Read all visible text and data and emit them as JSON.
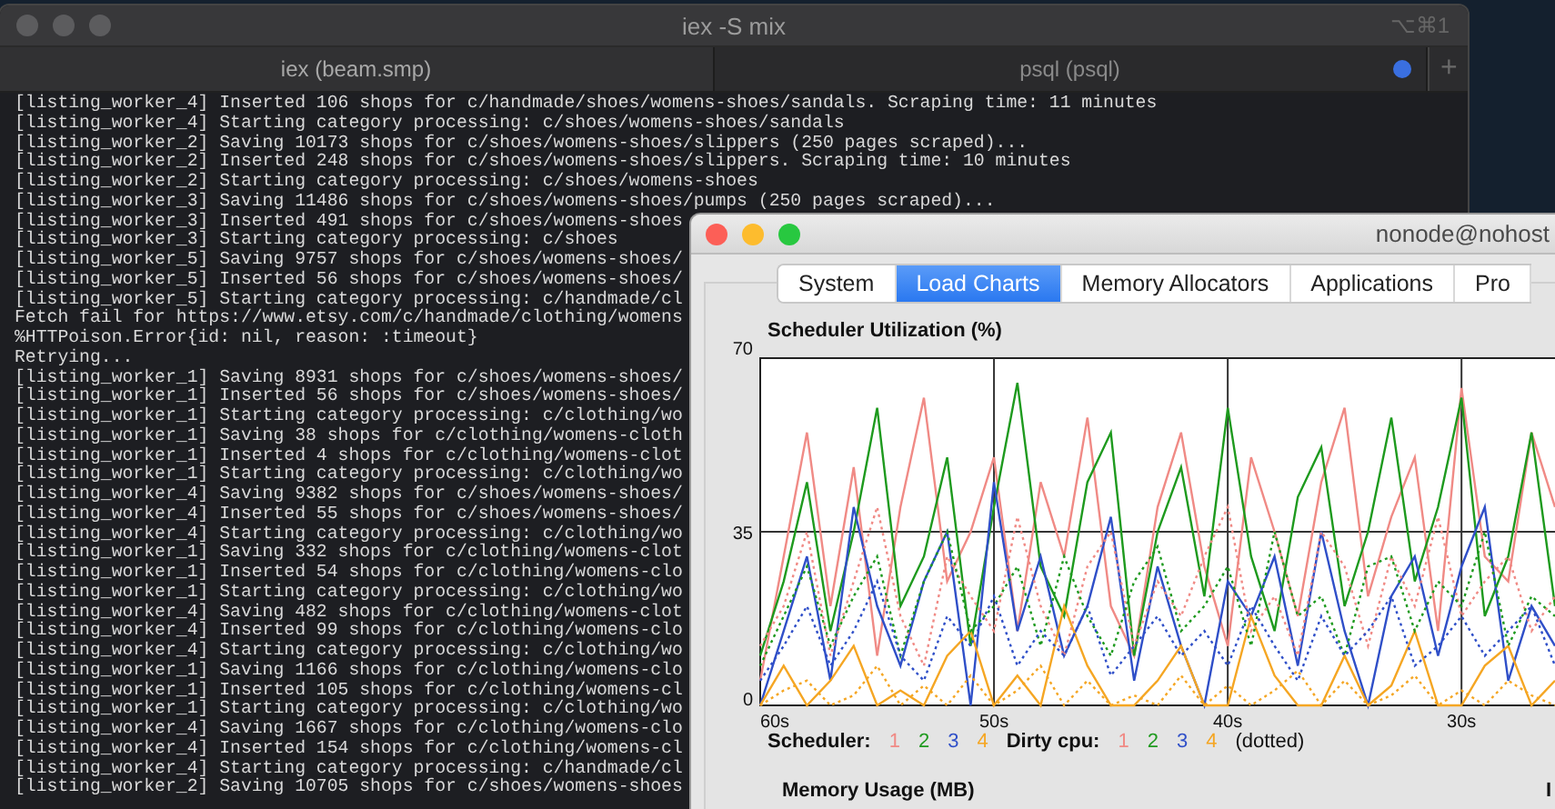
{
  "terminal": {
    "title": "iex -S mix",
    "shortcut": "⌥⌘1",
    "tabs": [
      {
        "label": "iex (beam.smp)",
        "selected": true,
        "activity": false
      },
      {
        "label": "psql (psql)",
        "selected": false,
        "activity": true
      }
    ],
    "new_tab": "+",
    "lines": [
      "[listing_worker_4] Inserted 106 shops for c/handmade/shoes/womens-shoes/sandals. Scraping time: 11 minutes",
      "[listing_worker_4] Starting category processing: c/shoes/womens-shoes/sandals",
      "[listing_worker_2] Saving 10173 shops for c/shoes/womens-shoes/slippers (250 pages scraped)...",
      "[listing_worker_2] Inserted 248 shops for c/shoes/womens-shoes/slippers. Scraping time: 10 minutes",
      "[listing_worker_2] Starting category processing: c/shoes/womens-shoes",
      "[listing_worker_3] Saving 11486 shops for c/shoes/womens-shoes/pumps (250 pages scraped)...",
      "[listing_worker_3] Inserted 491 shops for c/shoes/womens-shoes",
      "[listing_worker_3] Starting category processing: c/shoes",
      "[listing_worker_5] Saving 9757 shops for c/shoes/womens-shoes/",
      "[listing_worker_5] Inserted 56 shops for c/shoes/womens-shoes/",
      "[listing_worker_5] Starting category processing: c/handmade/cl",
      "Fetch fail for https://www.etsy.com/c/handmade/clothing/womens",
      "%HTTPoison.Error{id: nil, reason: :timeout}",
      "Retrying...",
      "[listing_worker_1] Saving 8931 shops for c/shoes/womens-shoes/",
      "[listing_worker_1] Inserted 56 shops for c/shoes/womens-shoes/",
      "[listing_worker_1] Starting category processing: c/clothing/wo",
      "[listing_worker_1] Saving 38 shops for c/clothing/womens-cloth",
      "[listing_worker_1] Inserted 4 shops for c/clothing/womens-clot",
      "[listing_worker_1] Starting category processing: c/clothing/wo",
      "[listing_worker_4] Saving 9382 shops for c/shoes/womens-shoes/",
      "[listing_worker_4] Inserted 55 shops for c/shoes/womens-shoes/",
      "[listing_worker_4] Starting category processing: c/clothing/wo",
      "[listing_worker_1] Saving 332 shops for c/clothing/womens-clot",
      "[listing_worker_1] Inserted 54 shops for c/clothing/womens-clo",
      "[listing_worker_1] Starting category processing: c/clothing/wo",
      "[listing_worker_4] Saving 482 shops for c/clothing/womens-clot",
      "[listing_worker_4] Inserted 99 shops for c/clothing/womens-clo",
      "[listing_worker_4] Starting category processing: c/clothing/wo",
      "[listing_worker_1] Saving 1166 shops for c/clothing/womens-clo",
      "[listing_worker_1] Inserted 105 shops for c/clothing/womens-cl",
      "[listing_worker_1] Starting category processing: c/clothing/wo",
      "[listing_worker_4] Saving 1667 shops for c/clothing/womens-clo",
      "[listing_worker_4] Inserted 154 shops for c/clothing/womens-cl",
      "[listing_worker_4] Starting category processing: c/handmade/cl",
      "[listing_worker_2] Saving 10705 shops for c/shoes/womens-shoes"
    ]
  },
  "observer": {
    "title": "nonode@nohost",
    "tabs": [
      {
        "label": "System",
        "selected": false
      },
      {
        "label": "Load Charts",
        "selected": true
      },
      {
        "label": "Memory Allocators",
        "selected": false
      },
      {
        "label": "Applications",
        "selected": false
      },
      {
        "label": "Pro",
        "selected": false
      }
    ],
    "scheduler_chart": {
      "chart_data": {
        "type": "line",
        "title": "Scheduler Utilization (%)",
        "grid": true,
        "x": [
          60,
          59,
          58,
          57,
          56,
          55,
          54,
          53,
          52,
          51,
          50,
          49,
          48,
          47,
          46,
          45,
          44,
          43,
          42,
          41,
          40,
          39,
          38,
          37,
          36,
          35,
          34,
          33,
          32,
          31,
          30,
          29,
          28,
          27,
          26
        ],
        "xlim": [
          60,
          26
        ],
        "ylim": [
          0,
          70
        ],
        "xticks": [
          {
            "value": 60,
            "label": "60s"
          },
          {
            "value": 50,
            "label": "50s"
          },
          {
            "value": 40,
            "label": "40s"
          },
          {
            "value": 30,
            "label": "30s"
          }
        ],
        "yticks": [
          0,
          35,
          70
        ],
        "series": [
          {
            "line_style": "solid",
            "color": "#f08a85",
            "values": [
              5,
              30,
              55,
              20,
              48,
              10,
              40,
              62,
              25,
              35,
              50,
              15,
              45,
              30,
              58,
              20,
              10,
              40,
              55,
              28,
              12,
              50,
              35,
              18,
              45,
              60,
              22,
              38,
              50,
              15,
              64,
              30,
              25,
              55,
              40
            ]
          },
          {
            "line_style": "solid",
            "color": "#1e9a1e",
            "values": [
              10,
              25,
              45,
              15,
              35,
              60,
              20,
              30,
              50,
              12,
              40,
              65,
              28,
              18,
              45,
              55,
              10,
              35,
              48,
              22,
              60,
              30,
              15,
              42,
              52,
              20,
              35,
              58,
              25,
              40,
              62,
              18,
              30,
              55,
              20
            ]
          },
          {
            "line_style": "solid",
            "color": "#2f4fc8",
            "values": [
              0,
              15,
              30,
              5,
              40,
              20,
              8,
              25,
              35,
              0,
              45,
              15,
              30,
              10,
              20,
              38,
              5,
              28,
              12,
              0,
              25,
              18,
              30,
              8,
              35,
              15,
              0,
              22,
              30,
              10,
              28,
              40,
              5,
              20,
              12
            ]
          },
          {
            "line_style": "solid",
            "color": "#f5a623",
            "values": [
              0,
              8,
              0,
              5,
              12,
              0,
              3,
              0,
              10,
              15,
              0,
              6,
              0,
              20,
              8,
              0,
              0,
              5,
              12,
              0,
              0,
              18,
              6,
              0,
              0,
              10,
              0,
              4,
              15,
              0,
              0,
              8,
              12,
              0,
              5
            ]
          },
          {
            "line_style": "dotted",
            "color": "#f08a85",
            "values": [
              12,
              20,
              35,
              10,
              25,
              40,
              18,
              8,
              30,
              22,
              15,
              38,
              20,
              10,
              28,
              35,
              12,
              25,
              18,
              30,
              40,
              15,
              22,
              10,
              35,
              28,
              12,
              30,
              20,
              38,
              18,
              25,
              30,
              15,
              22
            ]
          },
          {
            "line_style": "dotted",
            "color": "#1e9a1e",
            "values": [
              8,
              18,
              28,
              12,
              22,
              30,
              10,
              25,
              35,
              15,
              20,
              28,
              12,
              30,
              18,
              10,
              25,
              32,
              15,
              20,
              28,
              12,
              35,
              18,
              22,
              10,
              28,
              30,
              15,
              25,
              20,
              35,
              12,
              22,
              18
            ]
          },
          {
            "line_style": "dotted",
            "color": "#2f4fc8",
            "values": [
              5,
              12,
              20,
              8,
              15,
              25,
              10,
              5,
              18,
              12,
              22,
              8,
              15,
              10,
              20,
              6,
              12,
              18,
              10,
              15,
              8,
              20,
              12,
              5,
              18,
              10,
              15,
              22,
              8,
              12,
              18,
              10,
              15,
              20,
              8
            ]
          },
          {
            "line_style": "dotted",
            "color": "#f5a623",
            "values": [
              0,
              3,
              5,
              0,
              2,
              8,
              0,
              4,
              0,
              6,
              0,
              3,
              8,
              0,
              5,
              0,
              2,
              0,
              6,
              0,
              4,
              0,
              3,
              7,
              0,
              5,
              0,
              2,
              6,
              0,
              3,
              0,
              5,
              2,
              0
            ]
          }
        ]
      }
    },
    "legend": {
      "scheduler_label": "Scheduler:",
      "scheduler_items": [
        {
          "label": "1",
          "color": "#f08a85"
        },
        {
          "label": "2",
          "color": "#1e9a1e"
        },
        {
          "label": "3",
          "color": "#2f4fc8"
        },
        {
          "label": "4",
          "color": "#f5a623"
        }
      ],
      "dirty_label": "Dirty cpu:",
      "dirty_items": [
        {
          "label": "1",
          "color": "#f08a85"
        },
        {
          "label": "2",
          "color": "#1e9a1e"
        },
        {
          "label": "3",
          "color": "#2f4fc8"
        },
        {
          "label": "4",
          "color": "#f5a623"
        }
      ],
      "note": "(dotted)"
    },
    "memory_chart": {
      "title": "Memory Usage (MB)"
    },
    "column_2": {
      "title": "I"
    }
  }
}
